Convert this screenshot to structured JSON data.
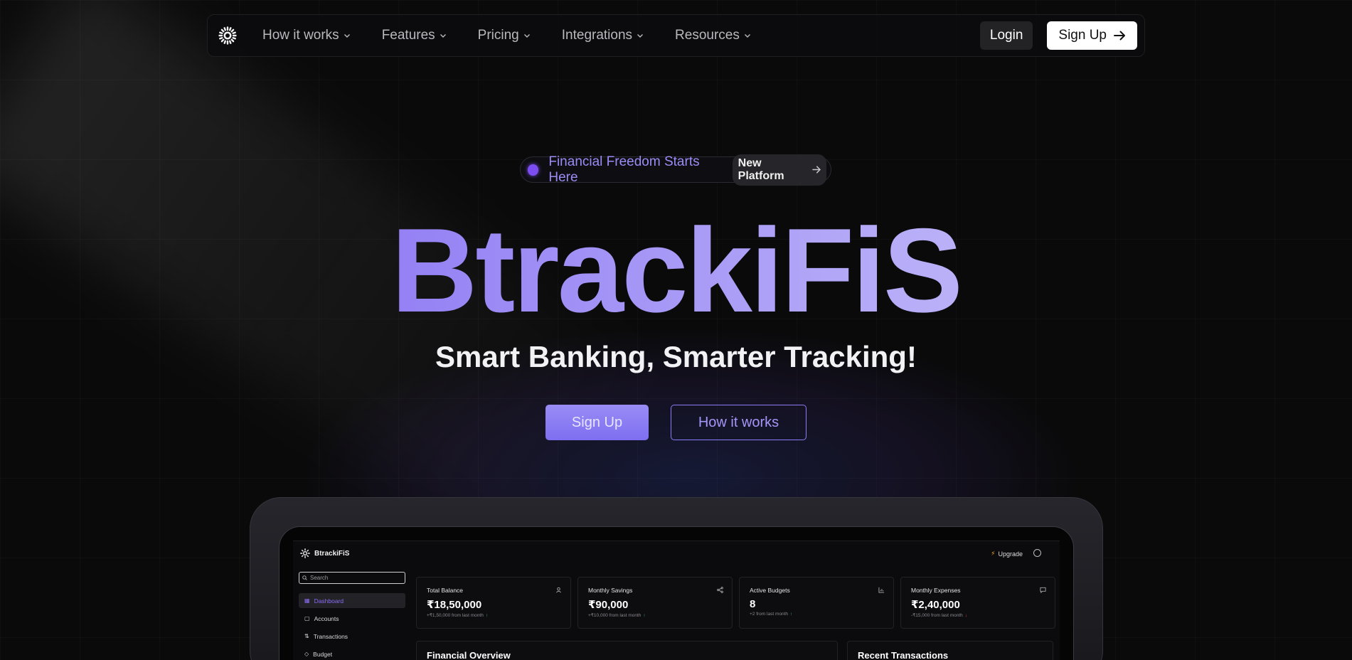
{
  "nav": {
    "links": [
      "How it works",
      "Features",
      "Pricing",
      "Integrations",
      "Resources"
    ],
    "login_label": "Login",
    "signup_label": "Sign Up"
  },
  "hero": {
    "pill_text": "Financial Freedom Starts Here",
    "pill_badge": "New Platform",
    "title": "BtrackiFiS",
    "subtitle": "Smart Banking, Smarter Tracking!",
    "primary_cta": "Sign Up",
    "secondary_cta": "How it works"
  },
  "dashboard": {
    "brand": "BtrackiFiS",
    "upgrade_label": "Upgrade",
    "search_placeholder": "Search",
    "sidebar": [
      "Dashboard",
      "Accounts",
      "Transactions",
      "Budget"
    ],
    "cards": [
      {
        "label": "Total Balance",
        "value": "₹18,50,000",
        "delta": "+₹1,50,000 from last month",
        "trend": "up"
      },
      {
        "label": "Monthly Savings",
        "value": "₹90,000",
        "delta": "+₹10,000 from last month",
        "trend": "up"
      },
      {
        "label": "Active Budgets",
        "value": "8",
        "delta": "+2 from last month",
        "trend": "up"
      },
      {
        "label": "Monthly Expenses",
        "value": "₹2,40,000",
        "delta": "-₹15,000 from last month",
        "trend": "down"
      }
    ],
    "panels": [
      "Financial Overview",
      "Recent Transactions"
    ]
  },
  "colors": {
    "accent": "#8b7cf5",
    "pill_dot": "#7c4df0",
    "trend_up": "#2ecc71",
    "trend_down": "#ef4444"
  }
}
